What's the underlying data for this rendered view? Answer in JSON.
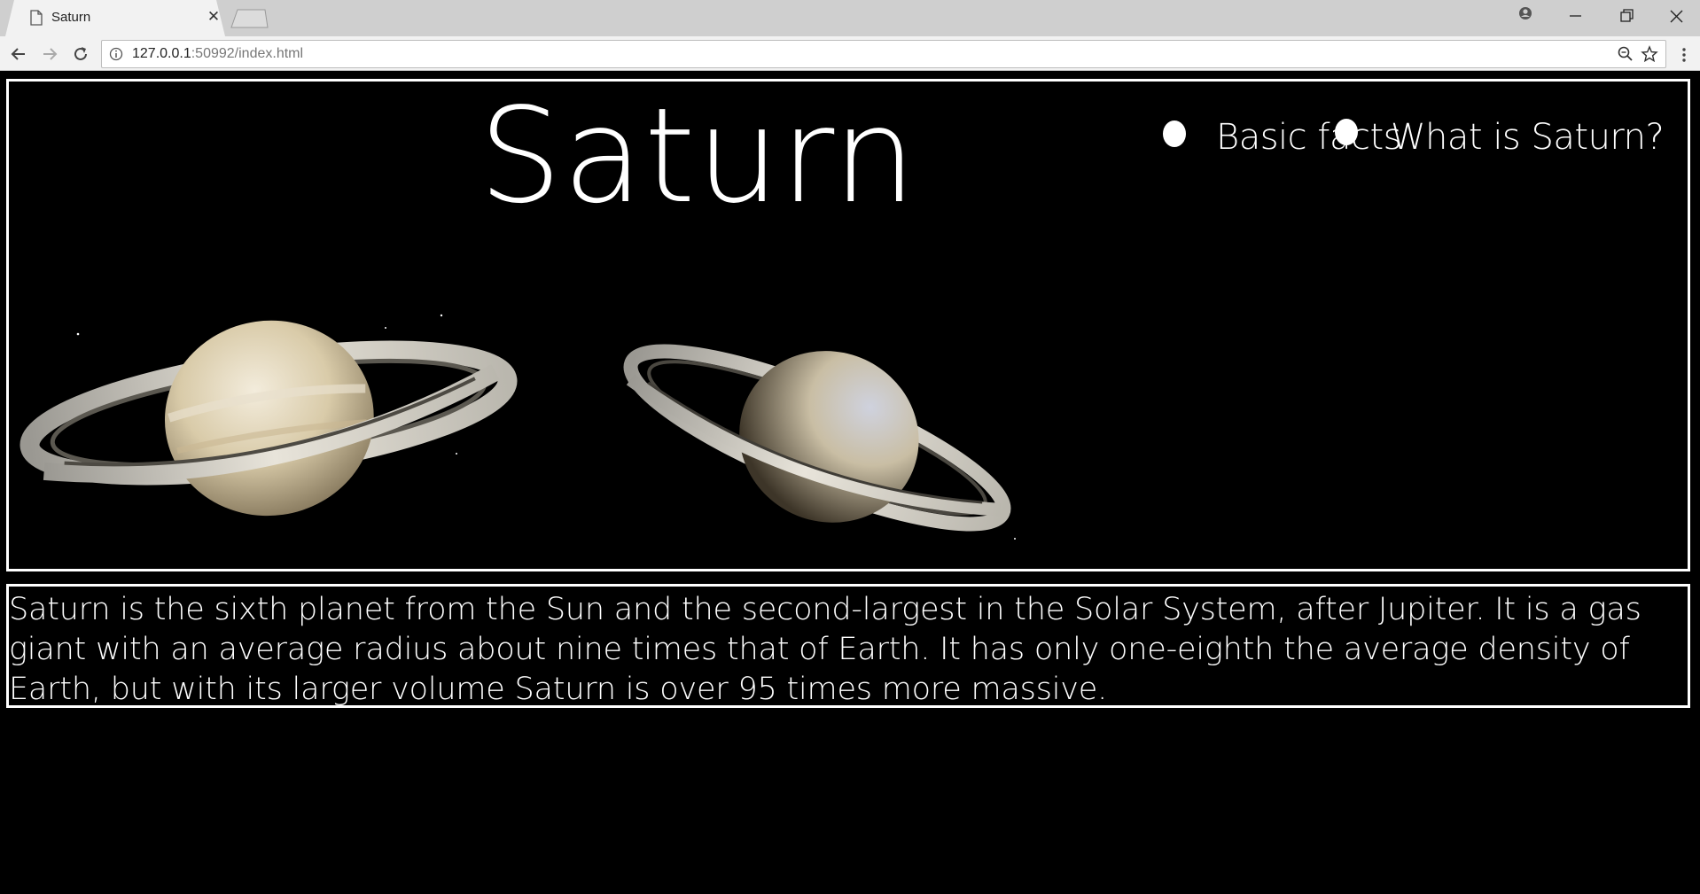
{
  "browser": {
    "tab_title": "Saturn",
    "tab_close": "✕",
    "url_host": "127.0.0.1",
    "url_rest": ":50992/index.html"
  },
  "page": {
    "title": "Saturn",
    "nav": [
      "Basic facts",
      "What is Saturn?"
    ],
    "description": "Saturn is the sixth planet from the Sun and the second-largest in the Solar System, after Jupiter. It is a gas giant with an average radius about nine times that of Earth. It has only one-eighth the average density of Earth, but with its larger volume Saturn is over 95 times more massive."
  },
  "colors": {
    "background": "#000000",
    "border": "#ffffff",
    "text": "#ffffff"
  }
}
